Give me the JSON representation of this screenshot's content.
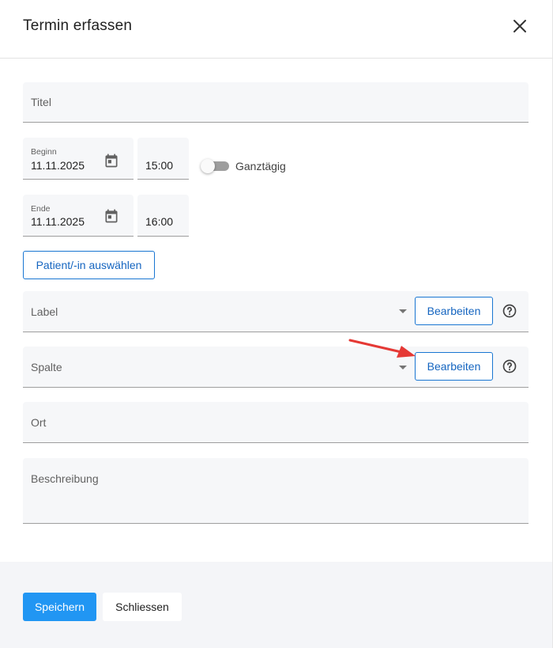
{
  "dialog": {
    "title": "Termin erfassen",
    "close_icon": "close-icon"
  },
  "form": {
    "title_field": {
      "label": "Titel",
      "value": ""
    },
    "start": {
      "label": "Beginn",
      "date": "11.11.2025",
      "time": "15:00",
      "icon": "calendar-icon"
    },
    "all_day": {
      "label": "Ganztägig",
      "checked": false
    },
    "end": {
      "label": "Ende",
      "date": "11.11.2025",
      "time": "16:00",
      "icon": "calendar-icon"
    },
    "select_patient_label": "Patient/-in auswählen",
    "label_field": {
      "label": "Label",
      "edit_label": "Bearbeiten",
      "help_icon": "help-circle-icon"
    },
    "column_field": {
      "label": "Spalte",
      "edit_label": "Bearbeiten",
      "help_icon": "help-circle-icon"
    },
    "location_field": {
      "label": "Ort",
      "value": ""
    },
    "description_field": {
      "label": "Beschreibung",
      "value": ""
    }
  },
  "footer": {
    "save_label": "Speichern",
    "close_label": "Schliessen"
  },
  "colors": {
    "primary": "#2196f3",
    "outline": "#1976d2",
    "annotation_arrow": "#e53935",
    "field_bg": "#f6f7f9",
    "footer_bg": "#f4f5f8"
  }
}
